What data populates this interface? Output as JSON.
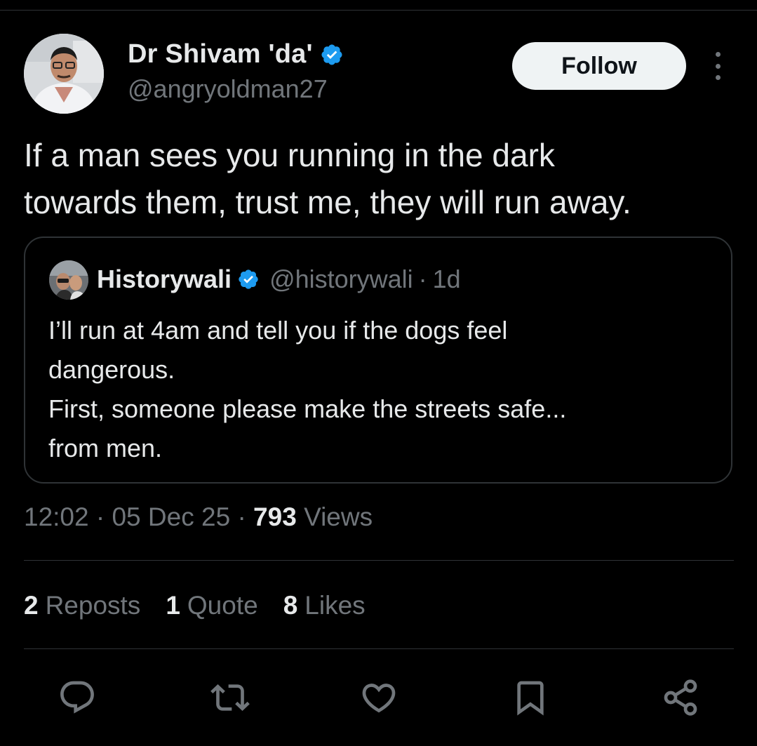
{
  "author": {
    "name": "Dr Shivam 'da'",
    "handle": "@angryoldman27",
    "verified_color": "#1d9bf0"
  },
  "follow_label": "Follow",
  "tweet": {
    "text": "If a man sees you running in the dark\ntowards them, trust me, they will run away."
  },
  "quote": {
    "name": "Historywali",
    "handle": "@historywali",
    "dot": "·",
    "time": "1d",
    "lines": [
      "I’ll run at 4am and tell you if the dogs feel",
      "dangerous.",
      "First, someone please make the streets safe...",
      "from men."
    ]
  },
  "meta": {
    "time": "12:02",
    "sep": "·",
    "date": "05 Dec 25",
    "views_count": "793",
    "views_label": "Views"
  },
  "stats": {
    "reposts_count": "2",
    "reposts_label": "Reposts",
    "quotes_count": "1",
    "quotes_label": "Quote",
    "likes_count": "8",
    "likes_label": "Likes"
  },
  "actions": [
    "reply-icon",
    "repost-icon",
    "like-icon",
    "bookmark-icon",
    "share-icon"
  ],
  "colors": {
    "background": "#000000",
    "text": "#e7e9ea",
    "muted": "#71767b",
    "border": "#2f3336",
    "verified": "#1d9bf0"
  }
}
